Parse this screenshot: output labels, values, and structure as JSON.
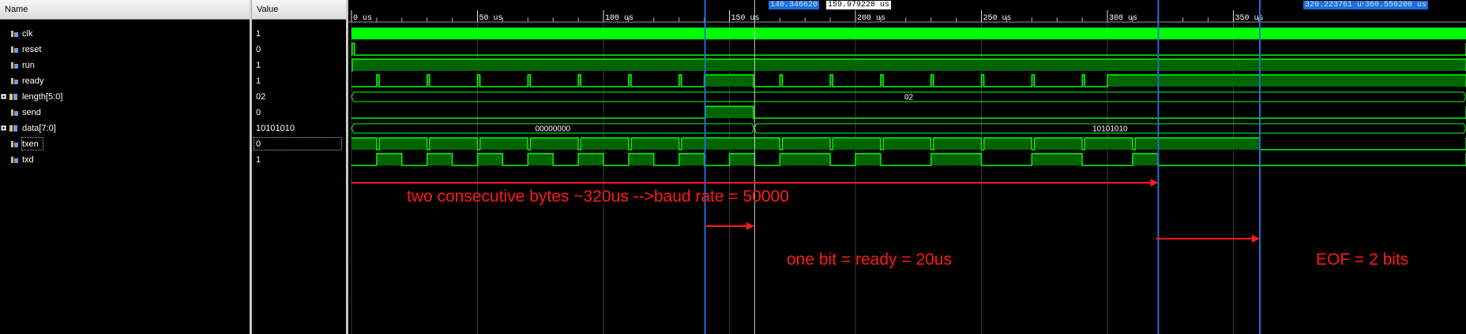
{
  "headers": {
    "name": "Name",
    "value": "Value"
  },
  "signals": [
    {
      "name": "clk",
      "value": "1",
      "bus": false
    },
    {
      "name": "reset",
      "value": "0",
      "bus": false
    },
    {
      "name": "run",
      "value": "1",
      "bus": false
    },
    {
      "name": "ready",
      "value": "1",
      "bus": false
    },
    {
      "name": "length[5:0]",
      "value": "02",
      "bus": true
    },
    {
      "name": "send",
      "value": "0",
      "bus": false
    },
    {
      "name": "data[7:0]",
      "value": "10101010",
      "bus": true
    },
    {
      "name": "txen",
      "value": "0",
      "bus": false
    },
    {
      "name": "txd",
      "value": "1",
      "bus": false
    }
  ],
  "timeline": {
    "ticks": [
      "0 us",
      "50 us",
      "100 us",
      "150 us",
      "200 us",
      "250 us",
      "300 us",
      "350 us"
    ]
  },
  "cursors": {
    "c1": "140.346620",
    "delta": "159.979228 us",
    "c2": "320.223761 us",
    "c3": "360.550200 us"
  },
  "bus_values": {
    "length": "02",
    "data_before": "00000000",
    "data_after": "10101010"
  },
  "annotations": {
    "a1": "two consecutive bytes ~320us -->baud rate = 50000",
    "a2": "one bit = ready = 20us",
    "a3": "EOF = 2 bits"
  },
  "colors": {
    "wave": "#00ff00",
    "fill": "#006400",
    "cursor": "#1e6fd9",
    "annotation": "#ff1a1a"
  }
}
